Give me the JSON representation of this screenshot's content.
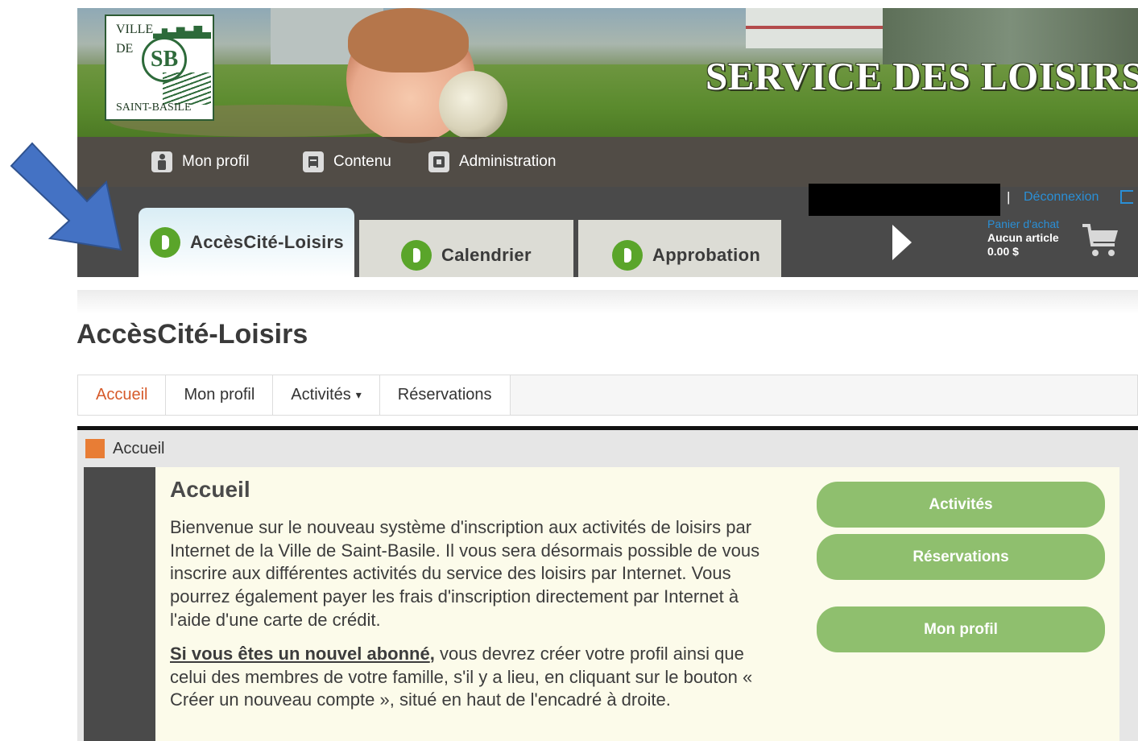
{
  "banner": {
    "logo": {
      "line1": "VILLE",
      "line2": "DE",
      "emblem": "SB",
      "line3": "SAINT-BASILE"
    },
    "title": "SERVICE DES LOISIRS"
  },
  "topnav": {
    "items": [
      {
        "label": "Mon profil",
        "icon": "person-icon"
      },
      {
        "label": "Contenu",
        "icon": "document-icon"
      },
      {
        "label": "Administration",
        "icon": "admin-icon"
      }
    ]
  },
  "tabs": [
    {
      "label": "AccèsCité-Loisirs",
      "active": true
    },
    {
      "label": "Calendrier",
      "active": false
    },
    {
      "label": "Approbation",
      "active": false
    }
  ],
  "account": {
    "separator": "|",
    "logout": "Déconnexion"
  },
  "cart": {
    "title": "Panier d'achat",
    "items": "Aucun article",
    "total": "0.00 $"
  },
  "page": {
    "title": "AccèsCité-Loisirs"
  },
  "subnav": [
    {
      "label": "Accueil",
      "active": true
    },
    {
      "label": "Mon profil",
      "active": false
    },
    {
      "label": "Activités",
      "active": false,
      "dropdown": "▾"
    },
    {
      "label": "Réservations",
      "active": false
    }
  ],
  "breadcrumb": {
    "label": "Accueil"
  },
  "content": {
    "heading": "Accueil",
    "paragraph1": "Bienvenue sur le nouveau système d'inscription aux activités de loisirs par Internet de la Ville de Saint-Basile. Il vous sera désormais possible de vous inscrire aux différentes activités du service des loisirs par Internet. Vous pourrez également payer les frais d'inscription directement par Internet à l'aide d'une carte de crédit.",
    "paragraph2_emphasis": "Si vous êtes un nouvel abonné",
    "paragraph2_comma": ",",
    "paragraph2_rest": " vous devrez créer votre profil ainsi que celui des membres de votre famille, s'il y a lieu, en cliquant sur le bouton « Créer un nouveau compte », situé en haut de l'encadré à droite."
  },
  "side_buttons": [
    "Activités",
    "Réservations",
    "Mon profil"
  ],
  "colors": {
    "tab_icon_green": "#5aa52a",
    "side_button_green": "#8fbf6e",
    "active_subnav": "#d65a2a",
    "link_blue": "#2a8fd6",
    "annotation_arrow": "#4472c4"
  }
}
